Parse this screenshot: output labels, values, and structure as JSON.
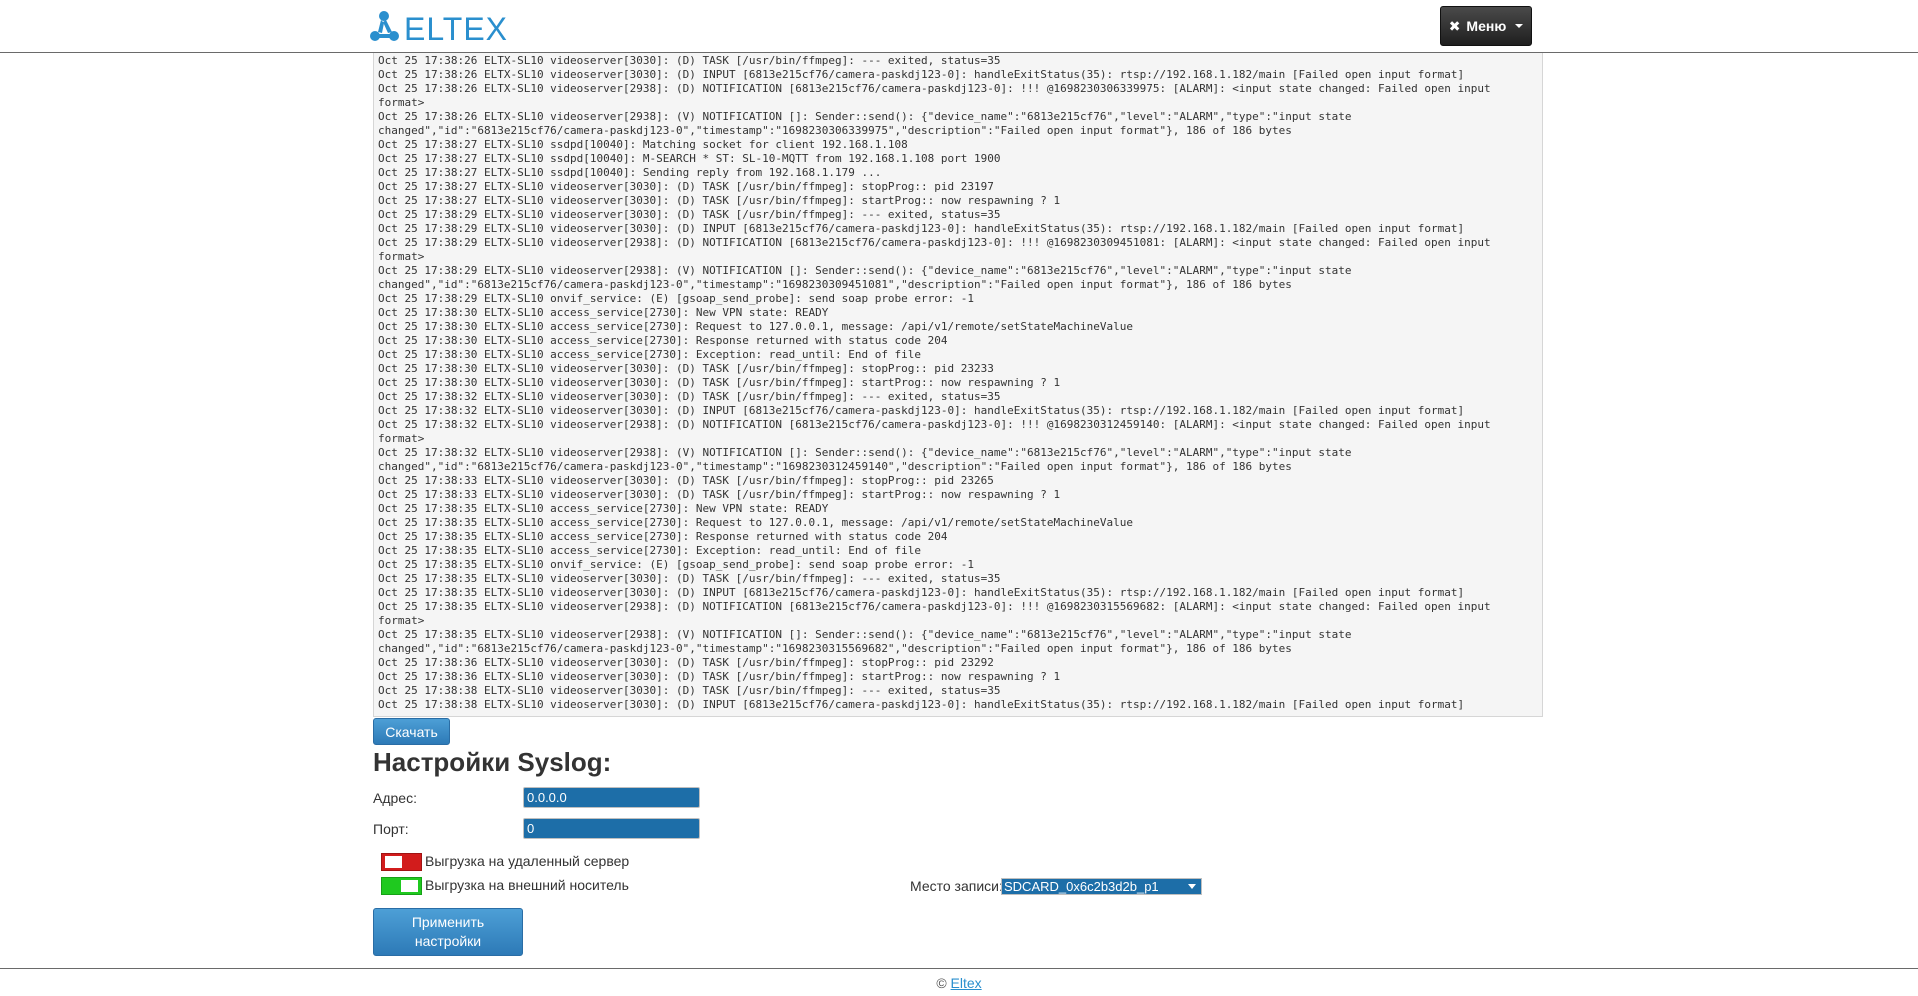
{
  "header": {
    "logo_text": "ELTEX",
    "menu_label": "Меню",
    "menu_icon": "wrench-screwdriver-icon"
  },
  "log": {
    "lines": [
      "Oct 25 17:38:26 ELTX-SL10 videoserver[3030]: (D) TASK [/usr/bin/ffmpeg]: --- exited, status=35",
      "Oct 25 17:38:26 ELTX-SL10 videoserver[3030]: (D) INPUT [6813e215cf76/camera-paskdj123-0]: handleExitStatus(35): rtsp://192.168.1.182/main [Failed open input format]",
      "Oct 25 17:38:26 ELTX-SL10 videoserver[2938]: (D) NOTIFICATION [6813e215cf76/camera-paskdj123-0]: !!! @1698230306339975: [ALARM]: <input state changed: Failed open input",
      "format>",
      "Oct 25 17:38:26 ELTX-SL10 videoserver[2938]: (V) NOTIFICATION []: Sender::send(): {\"device_name\":\"6813e215cf76\",\"level\":\"ALARM\",\"type\":\"input state",
      "changed\",\"id\":\"6813e215cf76/camera-paskdj123-0\",\"timestamp\":\"1698230306339975\",\"description\":\"Failed open input format\"}, 186 of 186 bytes",
      "Oct 25 17:38:27 ELTX-SL10 ssdpd[10040]: Matching socket for client 192.168.1.108",
      "Oct 25 17:38:27 ELTX-SL10 ssdpd[10040]: M-SEARCH * ST: SL-10-MQTT from 192.168.1.108 port 1900",
      "Oct 25 17:38:27 ELTX-SL10 ssdpd[10040]: Sending reply from 192.168.1.179 ...",
      "Oct 25 17:38:27 ELTX-SL10 videoserver[3030]: (D) TASK [/usr/bin/ffmpeg]: stopProg:: pid 23197",
      "Oct 25 17:38:27 ELTX-SL10 videoserver[3030]: (D) TASK [/usr/bin/ffmpeg]: startProg:: now respawning ? 1",
      "Oct 25 17:38:29 ELTX-SL10 videoserver[3030]: (D) TASK [/usr/bin/ffmpeg]: --- exited, status=35",
      "Oct 25 17:38:29 ELTX-SL10 videoserver[3030]: (D) INPUT [6813e215cf76/camera-paskdj123-0]: handleExitStatus(35): rtsp://192.168.1.182/main [Failed open input format]",
      "Oct 25 17:38:29 ELTX-SL10 videoserver[2938]: (D) NOTIFICATION [6813e215cf76/camera-paskdj123-0]: !!! @1698230309451081: [ALARM]: <input state changed: Failed open input",
      "format>",
      "Oct 25 17:38:29 ELTX-SL10 videoserver[2938]: (V) NOTIFICATION []: Sender::send(): {\"device_name\":\"6813e215cf76\",\"level\":\"ALARM\",\"type\":\"input state",
      "changed\",\"id\":\"6813e215cf76/camera-paskdj123-0\",\"timestamp\":\"1698230309451081\",\"description\":\"Failed open input format\"}, 186 of 186 bytes",
      "Oct 25 17:38:29 ELTX-SL10 onvif_service: (E) [gsoap_send_probe]: send soap probe error: -1",
      "Oct 25 17:38:30 ELTX-SL10 access_service[2730]: New VPN state: READY",
      "Oct 25 17:38:30 ELTX-SL10 access_service[2730]: Request to 127.0.0.1, message: /api/v1/remote/setStateMachineValue",
      "Oct 25 17:38:30 ELTX-SL10 access_service[2730]: Response returned with status code 204",
      "Oct 25 17:38:30 ELTX-SL10 access_service[2730]: Exception: read_until: End of file",
      "Oct 25 17:38:30 ELTX-SL10 videoserver[3030]: (D) TASK [/usr/bin/ffmpeg]: stopProg:: pid 23233",
      "Oct 25 17:38:30 ELTX-SL10 videoserver[3030]: (D) TASK [/usr/bin/ffmpeg]: startProg:: now respawning ? 1",
      "Oct 25 17:38:32 ELTX-SL10 videoserver[3030]: (D) TASK [/usr/bin/ffmpeg]: --- exited, status=35",
      "Oct 25 17:38:32 ELTX-SL10 videoserver[3030]: (D) INPUT [6813e215cf76/camera-paskdj123-0]: handleExitStatus(35): rtsp://192.168.1.182/main [Failed open input format]",
      "Oct 25 17:38:32 ELTX-SL10 videoserver[2938]: (D) NOTIFICATION [6813e215cf76/camera-paskdj123-0]: !!! @1698230312459140: [ALARM]: <input state changed: Failed open input",
      "format>",
      "Oct 25 17:38:32 ELTX-SL10 videoserver[2938]: (V) NOTIFICATION []: Sender::send(): {\"device_name\":\"6813e215cf76\",\"level\":\"ALARM\",\"type\":\"input state",
      "changed\",\"id\":\"6813e215cf76/camera-paskdj123-0\",\"timestamp\":\"1698230312459140\",\"description\":\"Failed open input format\"}, 186 of 186 bytes",
      "Oct 25 17:38:33 ELTX-SL10 videoserver[3030]: (D) TASK [/usr/bin/ffmpeg]: stopProg:: pid 23265",
      "Oct 25 17:38:33 ELTX-SL10 videoserver[3030]: (D) TASK [/usr/bin/ffmpeg]: startProg:: now respawning ? 1",
      "Oct 25 17:38:35 ELTX-SL10 access_service[2730]: New VPN state: READY",
      "Oct 25 17:38:35 ELTX-SL10 access_service[2730]: Request to 127.0.0.1, message: /api/v1/remote/setStateMachineValue",
      "Oct 25 17:38:35 ELTX-SL10 access_service[2730]: Response returned with status code 204",
      "Oct 25 17:38:35 ELTX-SL10 access_service[2730]: Exception: read_until: End of file",
      "Oct 25 17:38:35 ELTX-SL10 onvif_service: (E) [gsoap_send_probe]: send soap probe error: -1",
      "Oct 25 17:38:35 ELTX-SL10 videoserver[3030]: (D) TASK [/usr/bin/ffmpeg]: --- exited, status=35",
      "Oct 25 17:38:35 ELTX-SL10 videoserver[3030]: (D) INPUT [6813e215cf76/camera-paskdj123-0]: handleExitStatus(35): rtsp://192.168.1.182/main [Failed open input format]",
      "Oct 25 17:38:35 ELTX-SL10 videoserver[2938]: (D) NOTIFICATION [6813e215cf76/camera-paskdj123-0]: !!! @1698230315569682: [ALARM]: <input state changed: Failed open input",
      "format>",
      "Oct 25 17:38:35 ELTX-SL10 videoserver[2938]: (V) NOTIFICATION []: Sender::send(): {\"device_name\":\"6813e215cf76\",\"level\":\"ALARM\",\"type\":\"input state",
      "changed\",\"id\":\"6813e215cf76/camera-paskdj123-0\",\"timestamp\":\"1698230315569682\",\"description\":\"Failed open input format\"}, 186 of 186 bytes",
      "Oct 25 17:38:36 ELTX-SL10 videoserver[3030]: (D) TASK [/usr/bin/ffmpeg]: stopProg:: pid 23292",
      "Oct 25 17:38:36 ELTX-SL10 videoserver[3030]: (D) TASK [/usr/bin/ffmpeg]: startProg:: now respawning ? 1",
      "Oct 25 17:38:38 ELTX-SL10 videoserver[3030]: (D) TASK [/usr/bin/ffmpeg]: --- exited, status=35",
      "Oct 25 17:38:38 ELTX-SL10 videoserver[3030]: (D) INPUT [6813e215cf76/camera-paskdj123-0]: handleExitStatus(35): rtsp://192.168.1.182/main [Failed open input format]"
    ]
  },
  "actions": {
    "download_label": "Скачать",
    "apply_label": "Применить настройки"
  },
  "syslog": {
    "title": "Настройки Syslog:",
    "address_label": "Адрес:",
    "address_value": "0.0.0.0",
    "port_label": "Порт:",
    "port_value": "0",
    "remote_toggle_label": "Выгрузка на удаленный сервер",
    "remote_toggle_on": false,
    "external_toggle_label": "Выгрузка на внешний носитель",
    "external_toggle_on": true,
    "storage_label": "Место записи:",
    "storage_value": "SDCARD_0x6c2b3d2b_p1"
  },
  "footer": {
    "copyright": "©",
    "link_text": "Eltex"
  },
  "colors": {
    "brand_blue": "#2a8fce",
    "toggle_off": "#d21c1c",
    "toggle_on": "#1fc91f",
    "input_fill": "#1d6ea8"
  }
}
